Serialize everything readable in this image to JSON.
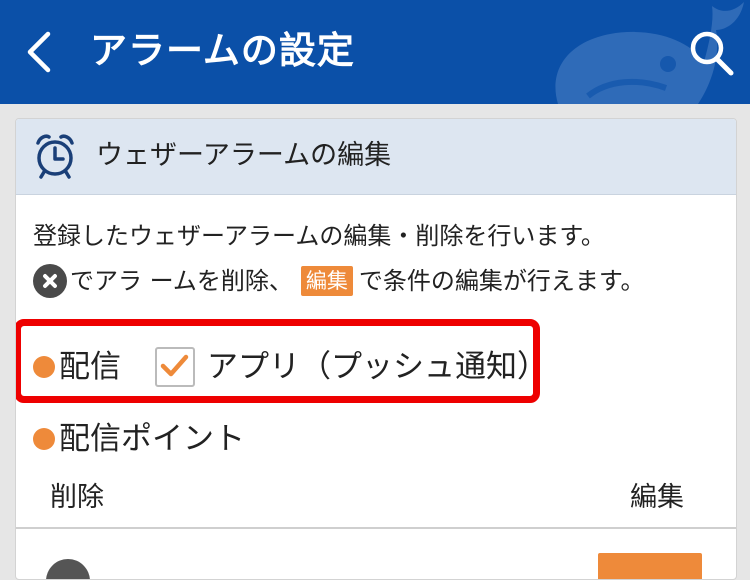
{
  "header": {
    "title": "アラームの設定",
    "bg_color": "#0b50a8"
  },
  "card": {
    "title": "ウェザーアラームの編集",
    "description_line1": "登録したウェザーアラームの編集・削除を行います。",
    "description_line2_a": "でアラ ームを削除、",
    "edit_badge_label": "編集",
    "description_line2_b": "で条件の編集が行えます。",
    "delivery_label": "配信",
    "delivery_option_label": "アプリ（プッシュ通知）",
    "delivery_option_checked": true,
    "points_label": "配信ポイント",
    "column_delete": "削除",
    "column_edit": "編集"
  },
  "colors": {
    "accent_orange": "#ee8a3a",
    "highlight_red": "#ee0000",
    "card_header_bg": "#dde6f1"
  }
}
